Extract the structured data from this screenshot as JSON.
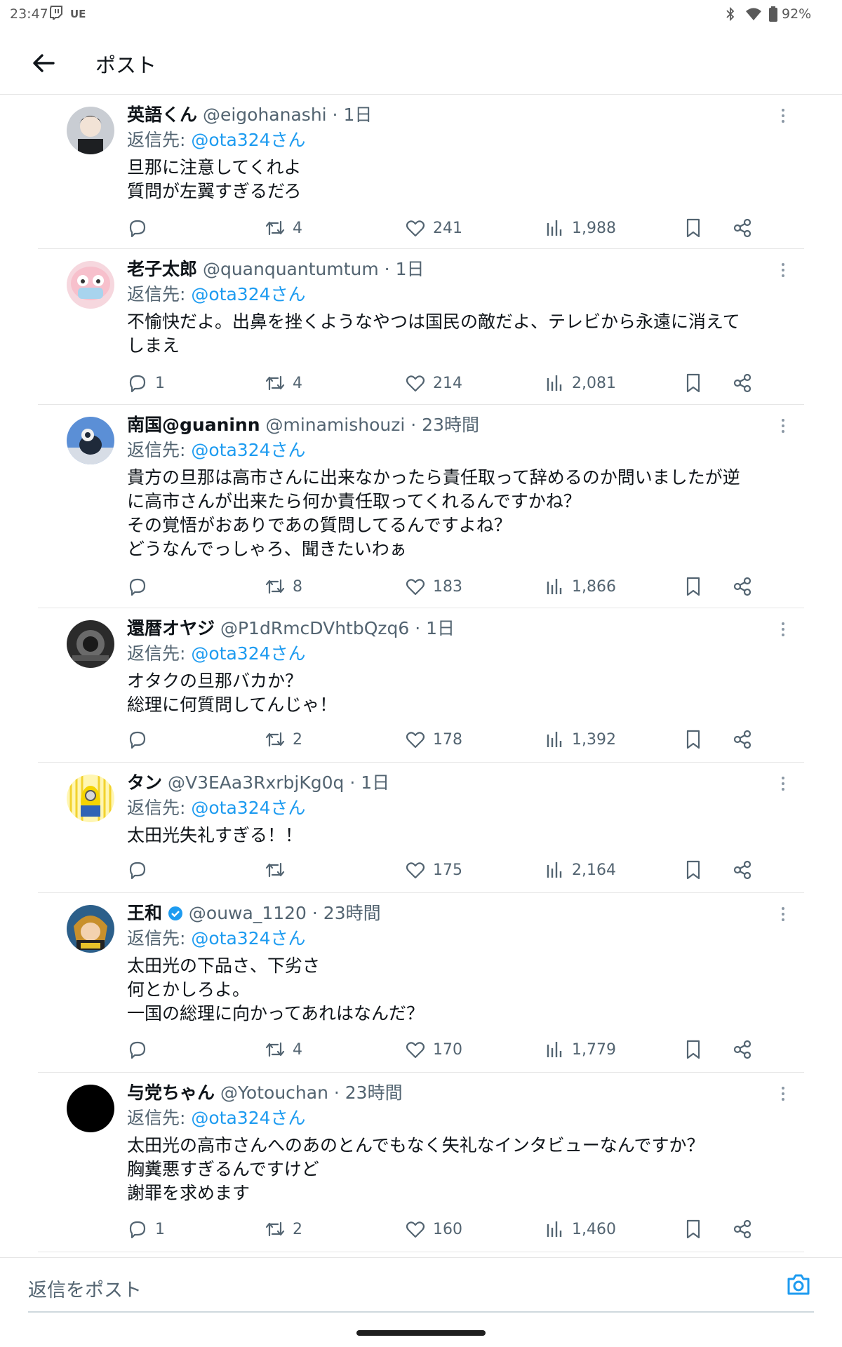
{
  "statusbar": {
    "time": "23:47",
    "carrier_badge": "UE",
    "battery": "92%"
  },
  "header": {
    "title": "ポスト"
  },
  "reply_prefix": "返信先: ",
  "reply_target": "@ota324さん",
  "tweets": [
    {
      "name": "英語くん",
      "handle": "@eigohanashi",
      "sep": " · ",
      "time": "1日",
      "text": "旦那に注意してくれよ\n質問が左翼すぎるだろ",
      "replies": "",
      "retweets": "4",
      "likes": "241",
      "views": "1,988"
    },
    {
      "name": "老子太郎",
      "handle": "@quanquantumtum",
      "sep": " · ",
      "time": "1日",
      "text": "不愉快だよ。出鼻を挫くようなやつは国民の敵だよ、テレビから永遠に消えて\nしまえ",
      "replies": "1",
      "retweets": "4",
      "likes": "214",
      "views": "2,081"
    },
    {
      "name": "南国@guaninn",
      "handle": "@minamishouzi",
      "sep": " · ",
      "time": "23時間",
      "text": "貴方の旦那は高市さんに出来なかったら責任取って辞めるのか問いましたが逆\nに高市さんが出来たら何か責任取ってくれるんですかね？\nその覚悟がおありであの質問してるんですよね？\nどうなんでっしゃろ、聞きたいわぁ",
      "replies": "",
      "retweets": "8",
      "likes": "183",
      "views": "1,866"
    },
    {
      "name": "還暦オヤジ",
      "handle": "@P1dRmcDVhtbQzq6",
      "sep": " · ",
      "time": "1日",
      "text": "オタクの旦那バカか？\n総理に何質問してんじゃ！",
      "replies": "",
      "retweets": "2",
      "likes": "178",
      "views": "1,392"
    },
    {
      "name": "タン",
      "handle": "@V3EAa3RxrbjKg0q",
      "sep": " · ",
      "time": "1日",
      "text": "太田光失礼すぎる！！",
      "replies": "",
      "retweets": "",
      "likes": "175",
      "views": "2,164"
    },
    {
      "name": "王和",
      "handle": "@ouwa_1120",
      "sep": " · ",
      "time": "23時間",
      "text": "太田光の下品さ、下劣さ\n何とかしろよ。\n一国の総理に向かってあれはなんだ？",
      "replies": "",
      "retweets": "4",
      "likes": "170",
      "views": "1,779"
    },
    {
      "name": "与党ちゃん",
      "handle": "@Yotouchan",
      "sep": " · ",
      "time": "23時間",
      "text": "太田光の高市さんへのあのとんでもなく失礼なインタビューなんですか？\n胸糞悪すぎるんですけど\n謝罪を求めます",
      "replies": "1",
      "retweets": "2",
      "likes": "160",
      "views": "1,460"
    }
  ],
  "composer": {
    "placeholder": "返信をポスト"
  },
  "colors": {
    "link": "#1d9bf0",
    "secondary_text": "#536471",
    "divider": "#e6e6e6"
  },
  "icons": [
    "back-arrow-icon",
    "more-icon",
    "reply-icon",
    "retweet-icon",
    "like-icon",
    "views-icon",
    "bookmark-icon",
    "share-icon",
    "camera-icon",
    "verified-badge-icon"
  ]
}
